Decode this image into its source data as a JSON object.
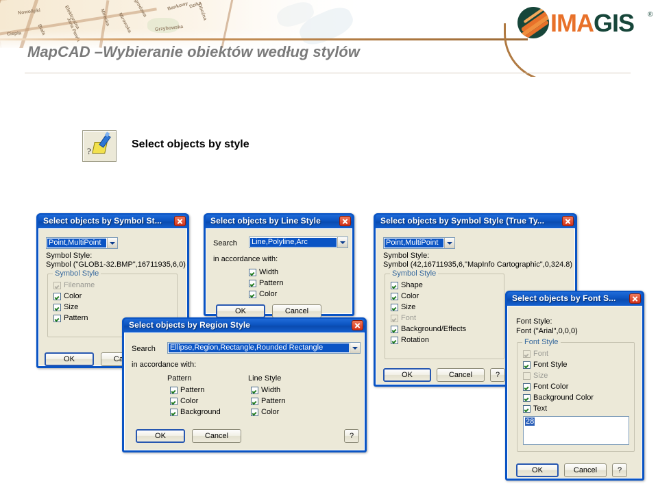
{
  "header": {
    "slide_title": "MapCAD –Wybieranie obiektów według stylów",
    "logo": {
      "part1": "IMA",
      "part2": "GIS",
      "registered": "®"
    },
    "map_labels": [
      "Nowolipki",
      "Elektoralna",
      "Mirecka",
      "Ogrodowa",
      "Biała",
      "Jana Pawła",
      "Mirowska",
      "Bankowy",
      "Ciepła",
      "Grzybowska",
      "Dzika",
      "Oboźna"
    ],
    "accent_color": "#b07a42"
  },
  "tool": {
    "icon": "question-brush-icon",
    "label": "Select objects by style"
  },
  "dialogs": {
    "symbol": {
      "title": "Select objects by Symbol St...",
      "combo_value": "Point,MultiPoint",
      "style_label": "Symbol Style:",
      "style_value": "Symbol (\"GLOB1-32.BMP\",16711935,6,0)",
      "group_title": "Symbol Style",
      "checks": [
        {
          "label": "Filename",
          "checked": true,
          "disabled": true
        },
        {
          "label": "Color",
          "checked": true,
          "disabled": false
        },
        {
          "label": "Size",
          "checked": true,
          "disabled": false
        },
        {
          "label": "Pattern",
          "checked": true,
          "disabled": false
        }
      ],
      "ok": "OK",
      "cancel": "Cancel"
    },
    "line": {
      "title": "Select objects by Line Style",
      "search_label": "Search",
      "combo_value": "Line,Polyline,Arc",
      "accordance_label": "in accordance with:",
      "checks": [
        {
          "label": "Width",
          "checked": true,
          "disabled": false
        },
        {
          "label": "Pattern",
          "checked": true,
          "disabled": false
        },
        {
          "label": "Color",
          "checked": true,
          "disabled": false
        }
      ],
      "ok": "OK",
      "cancel": "Cancel"
    },
    "symbol_tt": {
      "title": "Select objects by Symbol Style (True Ty...",
      "combo_value": "Point,MultiPoint",
      "style_label": "Symbol Style:",
      "style_value": "Symbol (42,16711935,6,\"MapInfo Cartographic\",0,324.8)",
      "group_title": "Symbol Style",
      "checks": [
        {
          "label": "Shape",
          "checked": true,
          "disabled": false
        },
        {
          "label": "Color",
          "checked": true,
          "disabled": false
        },
        {
          "label": "Size",
          "checked": true,
          "disabled": false
        },
        {
          "label": "Font",
          "checked": true,
          "disabled": true
        },
        {
          "label": "Background/Effects",
          "checked": true,
          "disabled": false
        },
        {
          "label": "Rotation",
          "checked": true,
          "disabled": false
        }
      ],
      "ok": "OK",
      "cancel": "Cancel",
      "help": "?"
    },
    "region": {
      "title": "Select objects by Region Style",
      "search_label": "Search",
      "combo_value": "Ellipse,Region,Rectangle,Rounded Rectangle",
      "accordance_label": "in accordance with:",
      "col1_title": "Pattern",
      "col2_title": "Line Style",
      "col1_checks": [
        {
          "label": "Pattern",
          "checked": true,
          "disabled": false
        },
        {
          "label": "Color",
          "checked": true,
          "disabled": false
        },
        {
          "label": "Background",
          "checked": true,
          "disabled": false
        }
      ],
      "col2_checks": [
        {
          "label": "Width",
          "checked": true,
          "disabled": false
        },
        {
          "label": "Pattern",
          "checked": true,
          "disabled": false
        },
        {
          "label": "Color",
          "checked": true,
          "disabled": false
        }
      ],
      "ok": "OK",
      "cancel": "Cancel",
      "help": "?"
    },
    "font": {
      "title": "Select objects by Font S...",
      "style_label": "Font Style:",
      "style_value": "Font (\"Arial\",0,0,0)",
      "group_title": "Font Style",
      "checks": [
        {
          "label": "Font",
          "checked": true,
          "disabled": true
        },
        {
          "label": "Font Style",
          "checked": true,
          "disabled": false
        },
        {
          "label": "Size",
          "checked": false,
          "disabled": true
        },
        {
          "label": "Font Color",
          "checked": true,
          "disabled": false
        },
        {
          "label": "Background Color",
          "checked": true,
          "disabled": false
        },
        {
          "label": "Text",
          "checked": true,
          "disabled": false
        }
      ],
      "text_value": "28",
      "ok": "OK",
      "cancel": "Cancel",
      "help": "?"
    }
  }
}
